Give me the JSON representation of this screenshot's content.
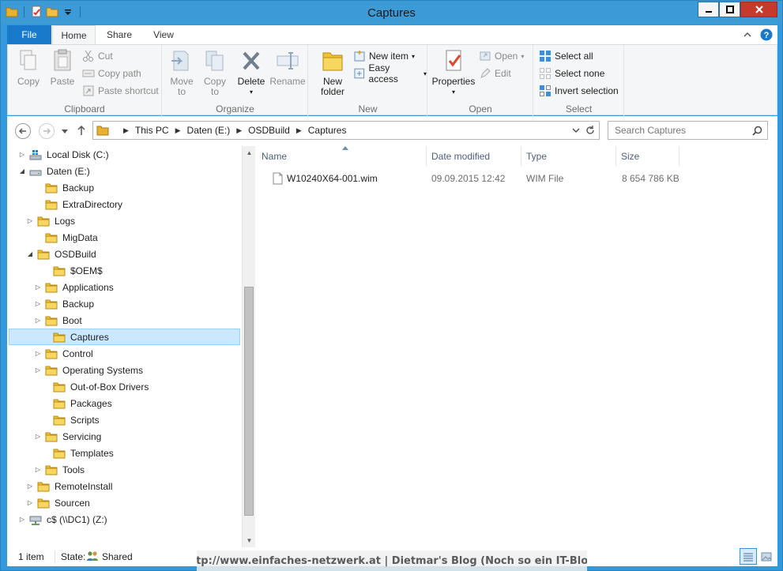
{
  "window": {
    "title": "Captures",
    "accent": "#3c9ad6"
  },
  "tabs": {
    "file": "File",
    "home": "Home",
    "share": "Share",
    "view": "View"
  },
  "ribbon": {
    "clipboard": {
      "label": "Clipboard",
      "copy": "Copy",
      "paste": "Paste",
      "cut": "Cut",
      "copy_path": "Copy path",
      "paste_shortcut": "Paste shortcut"
    },
    "organize": {
      "label": "Organize",
      "move_to_1": "Move",
      "move_to_2": "to",
      "copy_to_1": "Copy",
      "copy_to_2": "to",
      "delete": "Delete",
      "rename": "Rename"
    },
    "new": {
      "label": "New",
      "new_folder_1": "New",
      "new_folder_2": "folder",
      "new_item": "New item",
      "easy_access": "Easy access"
    },
    "open": {
      "label": "Open",
      "properties": "Properties",
      "open": "Open",
      "edit": "Edit"
    },
    "select": {
      "label": "Select",
      "select_all": "Select all",
      "select_none": "Select none",
      "invert_selection": "Invert selection"
    }
  },
  "address": {
    "crumbs": [
      "This PC",
      "Daten (E:)",
      "OSDBuild",
      "Captures"
    ],
    "search_placeholder": "Search Captures"
  },
  "tree": [
    {
      "label": "Local Disk (C:)",
      "icon": "drive-c-icon",
      "expander": "collapsed"
    },
    {
      "label": "Daten (E:)",
      "icon": "drive-icon",
      "expander": "expanded"
    },
    {
      "label": "Backup",
      "icon": "folder-icon",
      "expander": "none"
    },
    {
      "label": "ExtraDirectory",
      "icon": "folder-icon",
      "expander": "none"
    },
    {
      "label": "Logs",
      "icon": "folder-icon",
      "expander": "collapsed"
    },
    {
      "label": "MigData",
      "icon": "folder-icon",
      "expander": "none"
    },
    {
      "label": "OSDBuild",
      "icon": "folder-icon",
      "expander": "expanded"
    },
    {
      "label": "$OEM$",
      "icon": "folder-icon",
      "expander": "none"
    },
    {
      "label": "Applications",
      "icon": "folder-icon",
      "expander": "collapsed"
    },
    {
      "label": "Backup",
      "icon": "folder-icon",
      "expander": "collapsed"
    },
    {
      "label": "Boot",
      "icon": "folder-icon",
      "expander": "collapsed"
    },
    {
      "label": "Captures",
      "icon": "folder-icon",
      "expander": "none",
      "selected": true
    },
    {
      "label": "Control",
      "icon": "folder-icon",
      "expander": "collapsed"
    },
    {
      "label": "Operating Systems",
      "icon": "folder-icon",
      "expander": "collapsed"
    },
    {
      "label": "Out-of-Box Drivers",
      "icon": "folder-icon",
      "expander": "none"
    },
    {
      "label": "Packages",
      "icon": "folder-icon",
      "expander": "none"
    },
    {
      "label": "Scripts",
      "icon": "folder-icon",
      "expander": "none"
    },
    {
      "label": "Servicing",
      "icon": "folder-icon",
      "expander": "collapsed"
    },
    {
      "label": "Templates",
      "icon": "folder-icon",
      "expander": "none"
    },
    {
      "label": "Tools",
      "icon": "folder-icon",
      "expander": "collapsed"
    },
    {
      "label": "RemoteInstall",
      "icon": "folder-icon",
      "expander": "collapsed"
    },
    {
      "label": "Sourcen",
      "icon": "folder-icon",
      "expander": "collapsed"
    },
    {
      "label": "c$ (\\\\DC1) (Z:)",
      "icon": "network-drive-icon",
      "expander": "collapsed"
    }
  ],
  "columns": {
    "name": "Name",
    "date": "Date modified",
    "type": "Type",
    "size": "Size"
  },
  "files": [
    {
      "name": "W10240X64-001.wim",
      "date": "09.09.2015 12:42",
      "type": "WIM File",
      "size": "8 654 786 KB"
    }
  ],
  "status": {
    "count": "1 item",
    "state_label": "State:",
    "state_value": "Shared"
  },
  "watermark": "http://www.einfaches-netzwerk.at | Dietmar's Blog (Noch so ein IT-Blog)"
}
